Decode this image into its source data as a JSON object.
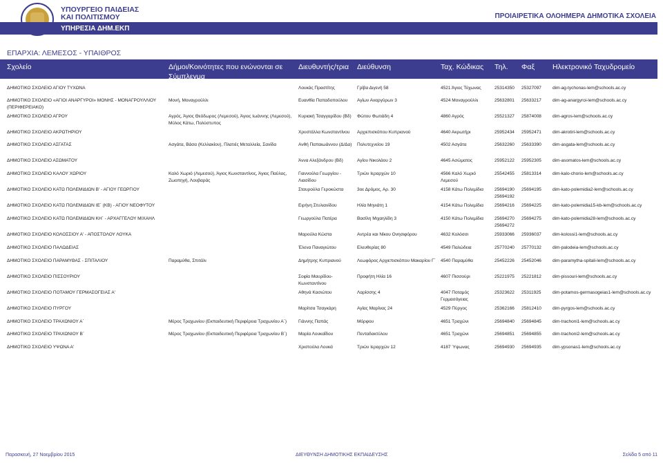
{
  "header": {
    "ministry_line1": "ΥΠΟΥΡΓΕΙΟ ΠΑΙΔΕΙΑΣ",
    "ministry_line2": "ΚΑΙ ΠΟΛΙΤΙΣΜΟΥ",
    "service": "ΥΠΗΡΕΣΙΑ ΔΗΜ.ΕΚΠ",
    "doc_title": "ΠΡΟΙΑΙΡΕΤΙΚΑ ΟΛΟΗΜΕΡΑ ΔΗΜΟΤΙΚΑ ΣΧΟΛΕΙΑ"
  },
  "region": "ΕΠΑΡΧΙΑ: ΛΕΜΕΣΟΣ - ΥΠΑΙΘΡΟΣ",
  "columns": {
    "school": "Σχολείο",
    "communities": "Δήμοι/Κοινότητες που ενώνονται σε Σύμπλεγμα",
    "head": "Διευθυντής/τρια",
    "address": "Διεύθυνση",
    "postal": "Ταχ. Κώδικας",
    "phone": "Τηλ.",
    "fax": "Φαξ",
    "email": "Ηλεκτρονικό Ταχυδρομείο"
  },
  "rows": [
    {
      "school": "ΔΗΜΟΤΙΚΟ ΣΧΟΛΕΙΟ ΑΓΙΟΥ ΤΥΧΩΝΑ",
      "communities": "",
      "head": "Λουκάς Πραστίτης",
      "address": "Γρίβα Διγενή 58",
      "postal": "4521 Άγιος Τύχωνας",
      "phone": "25314350",
      "fax": "25327097",
      "email": "dim-ag-tychonas-lem@schools.ac.cy"
    },
    {
      "school": "ΔΗΜΟΤΙΚΟ ΣΧΟΛΕΙΟ «ΑΓΙΟΙ ΑΝΑΡΓΥΡΟΙ» ΜΟΝΗΣ - ΜΟΝΑΓΡΟΥΛΛΙΟΥ (ΠΕΡΙΦΕΡΕΙΑΚΟ)",
      "communities": "Μονή, Μοναγρούλλι",
      "head": "Ευανθία Παπαδοπούλου",
      "address": "Αγίων Αναργύρων 3",
      "postal": "4524 Μοναγρούλλι",
      "phone": "25632801",
      "fax": "25633217",
      "email": "dim-ag-anargyroi-lem@schools.ac.cy"
    },
    {
      "school": "ΔΗΜΟΤΙΚΟ ΣΧΟΛΕΙΟ ΑΓΡΟΥ",
      "communities": "Αγρός, Άγιος Θεόδωρος (Λεμεσού), Άγιος Ιωάννης (Λεμεσού), Μύλος Κάτω, Πολύστυπος",
      "head": "Κυριακή Τσαγγαρίδου (Βδ)",
      "address": "Φώτου Φωτιάδη 4",
      "postal": "4860 Αγρός",
      "phone": "25521327",
      "fax": "25874008",
      "email": "dim-agros-lem@schools.ac.cy"
    },
    {
      "school": "ΔΗΜΟΤΙΚΟ ΣΧΟΛΕΙΟ ΑΚΡΩΤΗΡΙΟΥ",
      "communities": "",
      "head": "Χρυστάλλα Κωνσταντίνου",
      "address": "Αρχιεπισκόπου Κυπριανού",
      "postal": "4640 Ακρωτήρι",
      "phone": "25952434",
      "fax": "25952471",
      "email": "dim-akrotiri-lem@schools.ac.cy"
    },
    {
      "school": "ΔΗΜΟΤΙΚΟ ΣΧΟΛΕΙΟ ΑΣΓΑΤΑΣ",
      "communities": "Ασγάτα, Βάσα (Κελλακίου), Πλατιές Μεταλλεία, Σανίδα",
      "head": "Ανθή Παπαιωάννου (Δ/Δα)",
      "address": "Πολυτεχνείου 19",
      "postal": "4502 Ασγάτα",
      "phone": "25632260",
      "fax": "25633390",
      "email": "dim-asgata-lem@schools.ac.cy"
    },
    {
      "school": "ΔΗΜΟΤΙΚΟ ΣΧΟΛΕΙΟ ΑΣΩΜΑΤΟΥ",
      "communities": "",
      "head": "Άννα Αλεξάνδρου (Βδ)",
      "address": "Αγίου Νικολάου 2",
      "postal": "4645 Ασώματος",
      "phone": "25952122",
      "fax": "25952305",
      "email": "dim-asomatos-lem@schools.ac.cy"
    },
    {
      "school": "ΔΗΜΟΤΙΚΟ ΣΧΟΛΕΙΟ ΚΑΛΟΥ ΧΩΡΙΟΥ",
      "communities": "Καλό Χωριό (Λεμεσού), Άγιος Κωνσταντίνος, Άγιος Παύλος, Ζωοπηγή, Λουβαράς",
      "head": "Γιαννούλα Γεωργίου - Λιασίδου",
      "address": "Τριών Ιεραρχών 10",
      "postal": "4566 Καλό Χωριό Λεμεσού",
      "phone": "25542455",
      "fax": "25813314",
      "email": "dim-kalo-chorio-lem@schools.ac.cy"
    },
    {
      "school": "ΔΗΜΟΤΙΚΟ ΣΧΟΛΕΙΟ ΚΑΤΩ ΠΟΛΕΜΙΔΙΩΝ Β' - ΑΓΙΟΥ ΓΕΩΡΓΙΟΥ",
      "communities": "",
      "head": "Σταυρούλα Γεροκώστα",
      "address": "3οε Δρόμος, Αρ. 30",
      "postal": "4158 Κάτω Πολεμίδια",
      "phone": "25694190 25694192",
      "fax": "25694195",
      "email": "dim-kato-polemidia2-lem@schools.ac.cy"
    },
    {
      "school": "ΔΗΜΟΤΙΚΟ ΣΧΟΛΕΙΟ ΚΑΤΩ ΠΟΛΕΜΙΔΙΩΝ ΙΕ΄ (ΚΒ) - ΑΓΙΟΥ ΝΕΟΦΥΤΟΥ",
      "communities": "",
      "head": "Ειρήνη Στυλιανίδου",
      "address": "Ηλία Μηνιάτη 1",
      "postal": "4154 Κάτω Πολεμίδια",
      "phone": "25694216",
      "fax": "25694225",
      "email": "dim-kato-polemidia15-kb-lem@schools.ac.cy"
    },
    {
      "school": "ΔΗΜΟΤΙΚΟ ΣΧΟΛΕΙΟ ΚΑΤΩ ΠΟΛΕΜΙΔΙΩΝ ΚΗ΄ - ΑΡΧΑΓΓΕΛΟΥ ΜΙΧΑΗΛ",
      "communities": "",
      "head": "Γεωργούλα Πατέρα",
      "address": "Βασίλη Μιχαηλίδη 3",
      "postal": "4150 Κάτω Πολεμίδια",
      "phone": "25694270 25694272",
      "fax": "25694275",
      "email": "dim-kato-polemidia28-lem@schools.ac.cy"
    },
    {
      "school": "ΔΗΜΟΤΙΚΟ ΣΧΟΛΕΙΟ ΚΟΛΟΣΣΙΟΥ Α' - ΑΠΟΣΤΟΛΟΥ ΛΟΥΚΑ",
      "communities": "",
      "head": "Μαρούλα Κώστα",
      "address": "Αντρέα και Νίκου Ονησιφόρου",
      "postal": "4632 Κολόσσι",
      "phone": "25933066",
      "fax": "25936037",
      "email": "dim-kolossi1-lem@schools.ac.cy"
    },
    {
      "school": "ΔΗΜΟΤΙΚΟ ΣΧΟΛΕΙΟ ΠΑΛΩΔΕΙΑΣ",
      "communities": "",
      "head": "Έλενα Παναγιώτου",
      "address": "Ελευθερίας 80",
      "postal": "4549 Παλώδεια",
      "phone": "25770240",
      "fax": "25770132",
      "email": "dim-palodeia-lem@schools.ac.cy"
    },
    {
      "school": "ΔΗΜΟΤΙΚΟ ΣΧΟΛΕΙΟ ΠΑΡΑΜΥΘΑΣ - ΣΠΙΤΑΛΙΟΥ",
      "communities": "Παραμύθα, Σπιτάλι",
      "head": "Δημήτρης Κυπριανού",
      "address": "Λεωφόρος Αρχιεπισκόπου Μακαρίου Γ΄",
      "postal": "4540 Παραμύθα",
      "phone": "25452226",
      "fax": "25452046",
      "email": "dim-paramytha-spitali-lem@schools.ac.cy"
    },
    {
      "school": "ΔΗΜΟΤΙΚΟ ΣΧΟΛΕΙΟ ΠΙΣΣΟΥΡΙΟΥ",
      "communities": "",
      "head": "Σοφία Μαυρίδου-Κωνσταντίνου",
      "address": "Προφήτη Ηλία 16",
      "postal": "4607 Πισσούρι",
      "phone": "25221975",
      "fax": "25221812",
      "email": "dim-pissouri-lem@schools.ac.cy"
    },
    {
      "school": "ΔΗΜΟΤΙΚΟ ΣΧΟΛΕΙΟ ΠΟΤΑΜΟΥ ΓΕΡΜΑΣΟΓΕΙΑΣ Α'",
      "communities": "",
      "head": "Αθηνά Κασιώτου",
      "address": "Λαρίσσης 4",
      "postal": "4047 Ποταμός Γερμασόγειας",
      "phone": "25323622",
      "fax": "25311925",
      "email": "dim-potamos-germasogeias1-lem@schools.ac.cy"
    },
    {
      "school": "ΔΗΜΟΤΙΚΟ ΣΧΟΛΕΙΟ ΠΥΡΓΟΥ",
      "communities": "",
      "head": "Μαρίτσα Τσαγκάρη",
      "address": "Αγίας Μαρίνας 24",
      "postal": "4529 Πύργος",
      "phone": "25362166",
      "fax": "25812410",
      "email": "dim-pyrgos-lem@schools.ac.cy"
    },
    {
      "school": "ΔΗΜΟΤΙΚΟ ΣΧΟΛΕΙΟ ΤΡΑΧΩΝΙΟΥ Α΄",
      "communities": "Μέρος Τραχωνίου (Εκπαιδευτική Περιφέρεια Τραχωνίου Α΄)",
      "head": "Γιάννης Παπάς",
      "address": "Μόρφου",
      "postal": "4651 Τραχώνι",
      "phone": "25694840",
      "fax": "25694845",
      "email": "dim-trachoni1-lem@schools.ac.cy"
    },
    {
      "school": "ΔΗΜΟΤΙΚΟ ΣΧΟΛΕΙΟ ΤΡΑΧΩΝΙΟΥ Β΄",
      "communities": "Μέρος Τραχωνίου (Εκπαιδευτική Περιφέρεια Τραχωνίου Β΄)",
      "head": "Μαρία Λουκαΐδου",
      "address": "Πενταδακτύλου",
      "postal": "4651 Τραχώνι",
      "phone": "25694851",
      "fax": "25694855",
      "email": "dim-trachoni2-lem@schools.ac.cy"
    },
    {
      "school": "ΔΗΜΟΤΙΚΟ ΣΧΟΛΕΙΟ ΥΨΩΝΑ Α'",
      "communities": "",
      "head": "Χριστούλα Λουκά",
      "address": "Τριών Ιεραρχών 12",
      "postal": "4187 Ύψωνας",
      "phone": "25694930",
      "fax": "25694935",
      "email": "dim-ypsonas1-lem@schools.ac.cy"
    }
  ],
  "footer": {
    "date": "Παρασκευή, 27 Νοεμβρίου 2015",
    "department": "ΔΙΕΥΘΥΝΣΗ ΔΗΜΟΤΙΚΗΣ ΕΚΠΑΙΔΕΥΣΗΣ",
    "page": "Σελίδα 5 από 11"
  },
  "colors": {
    "brand": "#3d3d8f"
  }
}
